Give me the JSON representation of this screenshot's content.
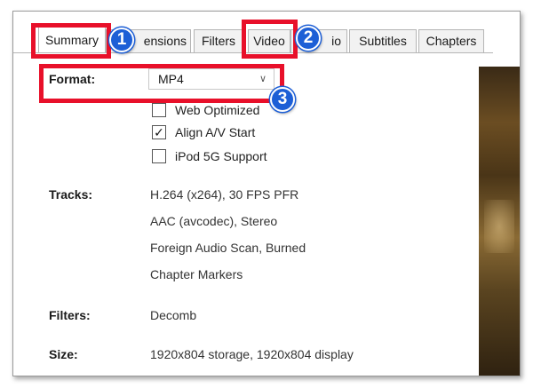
{
  "tabs": [
    {
      "label": "Summary"
    },
    {
      "label": "ensions"
    },
    {
      "label": "Filters"
    },
    {
      "label": "Video"
    },
    {
      "label": "io"
    },
    {
      "label": "Subtitles"
    },
    {
      "label": "Chapters"
    }
  ],
  "badges": [
    "1",
    "2",
    "3"
  ],
  "format": {
    "label": "Format:",
    "value": "MP4"
  },
  "options": [
    {
      "label": "Web Optimized",
      "checked": false
    },
    {
      "label": "Align A/V Start",
      "checked": true
    },
    {
      "label": "iPod 5G Support",
      "checked": false
    }
  ],
  "tracks": {
    "label": "Tracks:",
    "items": [
      "H.264 (x264), 30 FPS PFR",
      "AAC (avcodec), Stereo",
      "Foreign Audio Scan, Burned",
      "Chapter Markers"
    ]
  },
  "filters": {
    "label": "Filters:",
    "value": "Decomb"
  },
  "size": {
    "label": "Size:",
    "value": "1920x804 storage, 1920x804 display"
  },
  "colors": {
    "highlight": "#e8102a",
    "badge": "#1d5fd6"
  }
}
